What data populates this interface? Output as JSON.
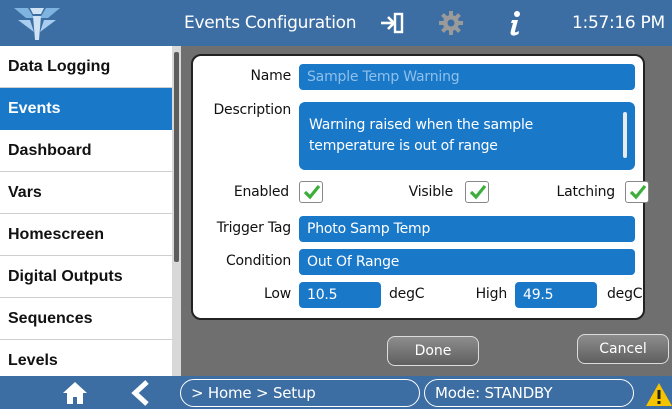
{
  "header": {
    "title": "Events Configuration",
    "time": "1:57:16 PM",
    "icons": [
      "logo-icon",
      "exit-icon",
      "gear-icon",
      "info-icon"
    ]
  },
  "sidebar": {
    "items": [
      {
        "label": "Data Logging",
        "active": false
      },
      {
        "label": "Events",
        "active": true
      },
      {
        "label": "Dashboard",
        "active": false
      },
      {
        "label": "Vars",
        "active": false
      },
      {
        "label": "Homescreen",
        "active": false
      },
      {
        "label": "Digital Outputs",
        "active": false
      },
      {
        "label": "Sequences",
        "active": false
      },
      {
        "label": "Levels",
        "active": false
      }
    ]
  },
  "form": {
    "name_label": "Name",
    "name_value": "Sample Temp Warning",
    "description_label": "Description",
    "description_value": "Warning raised when the sample temperature is out of range",
    "enabled_label": "Enabled",
    "enabled": true,
    "visible_label": "Visible",
    "visible": true,
    "latching_label": "Latching",
    "latching": true,
    "trigger_tag_label": "Trigger Tag",
    "trigger_tag_value": "Photo Samp Temp",
    "condition_label": "Condition",
    "condition_value": "Out Of Range",
    "low_label": "Low",
    "low_value": "10.5",
    "low_unit": "degC",
    "high_label": "High",
    "high_value": "49.5",
    "high_unit": "degC"
  },
  "buttons": {
    "done": "Done",
    "cancel": "Cancel"
  },
  "footer": {
    "breadcrumb": "> Home > Setup",
    "mode": "Mode: STANDBY",
    "icons": [
      "home-icon",
      "back-icon",
      "warning-icon"
    ]
  },
  "colors": {
    "bar_blue": "#3c6ea3",
    "field_blue": "#1a78c9",
    "checkbox_green": "#3cae3c",
    "warning_yellow": "#f5c400"
  }
}
